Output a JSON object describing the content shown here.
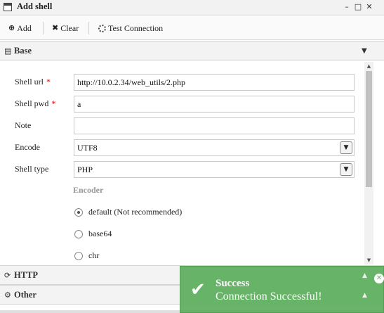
{
  "window": {
    "title": "Add shell",
    "min_glyph": "–",
    "max_glyph": "□",
    "close_glyph": "✕"
  },
  "toolbar": {
    "add_label": "Add",
    "clear_label": "Clear",
    "test_label": "Test Connection"
  },
  "sections": {
    "base": "Base",
    "http": "HTTP",
    "other": "Other"
  },
  "form": {
    "shell_url_label": "Shell url",
    "shell_url_value": "http://10.0.2.34/web_utils/2.php",
    "shell_pwd_label": "Shell pwd",
    "shell_pwd_value": "a",
    "note_label": "Note",
    "note_value": "",
    "encode_label": "Encode",
    "encode_value": "UTF8",
    "shell_type_label": "Shell type",
    "shell_type_value": "PHP",
    "required_mark": "*"
  },
  "encoder": {
    "title": "Encoder",
    "options": [
      {
        "label": "default (Not recommended)",
        "selected": true
      },
      {
        "label": "base64",
        "selected": false
      },
      {
        "label": "chr",
        "selected": false
      }
    ]
  },
  "toast": {
    "title": "Success",
    "message": "Connection Successful!",
    "color": "#62b162"
  },
  "icons": {
    "add": "plus-circle-icon",
    "clear": "x-icon",
    "test": "spinner-icon",
    "base": "file-icon",
    "http": "refresh-icon",
    "other": "cogs-icon"
  }
}
